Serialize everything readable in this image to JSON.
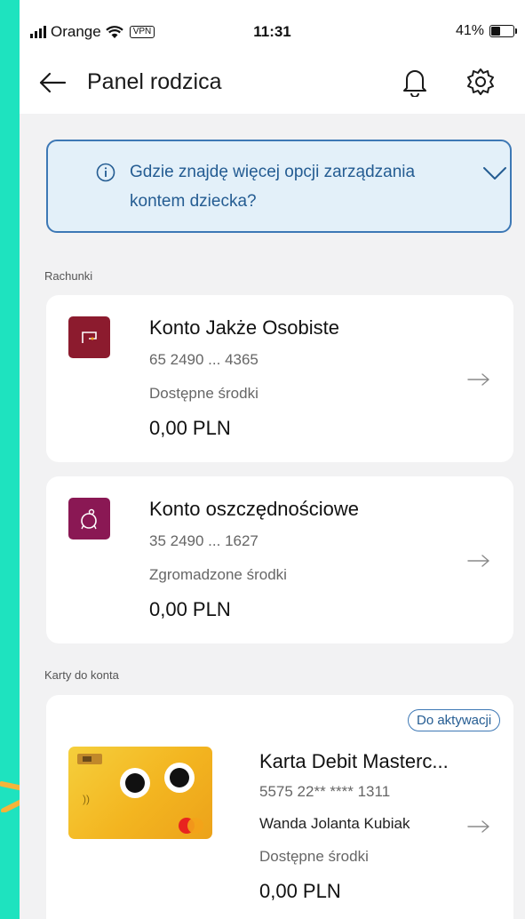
{
  "status": {
    "carrier": "Orange",
    "vpn": "VPN",
    "time": "11:31",
    "battery": "41%"
  },
  "header": {
    "title": "Panel rodzica"
  },
  "info": {
    "text": "Gdzie znajdę więcej opcji zarządzania kontem dziecka?"
  },
  "sections": {
    "accounts": "Rachunki",
    "cards": "Karty do konta"
  },
  "accounts": [
    {
      "name": "Konto Jakże Osobiste",
      "number": "65 2490 ... 4365",
      "label": "Dostępne środki",
      "amount": "0,00 PLN",
      "color": "#8c1b2e"
    },
    {
      "name": "Konto oszczędnościowe",
      "number": "35 2490 ... 1627",
      "label": "Zgromadzone środki",
      "amount": "0,00 PLN",
      "color": "#8a1854"
    }
  ],
  "card": {
    "badge": "Do aktywacji",
    "name": "Karta Debit Masterc...",
    "number": "5575 22** **** 1311",
    "holder": "Wanda Jolanta Kubiak",
    "label": "Dostępne środki",
    "amount": "0,00 PLN"
  },
  "icons": [
    "back-arrow-icon",
    "bell-icon",
    "gear-icon",
    "info-icon",
    "chevron-down-icon",
    "arrow-right-icon",
    "wallet-icon",
    "piggy-bank-icon"
  ],
  "colors": {
    "background": "#1ee3bf",
    "accent_blue": "#245c92",
    "info_bg": "#e3f0f9"
  }
}
